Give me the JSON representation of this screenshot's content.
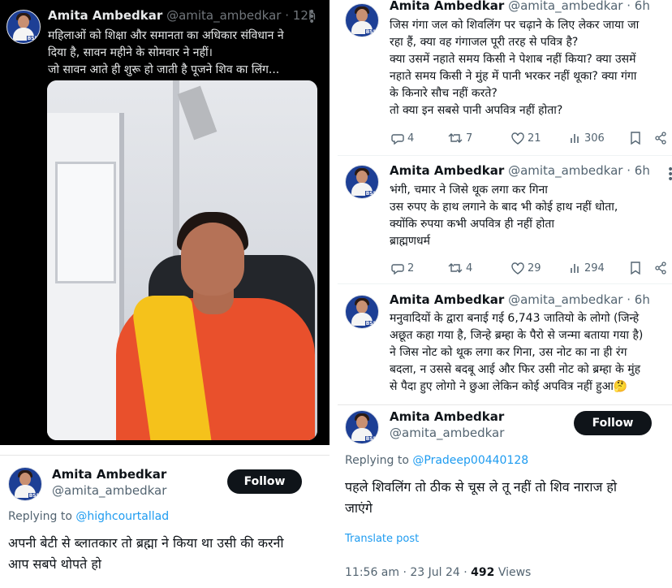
{
  "tweets": [
    {
      "id": "t1",
      "name": "Amita Ambedkar",
      "handle": "@amita_ambedkar",
      "time": "12h",
      "lines": [
        "महिलाओं को शिक्षा और समानता का अधिकार संविधान ने",
        "दिया है, सावन महीने के सोमवार ने नहीं।",
        "जो सावन आते ही शुरू हो जाती है पूजने शिव का लिंग..."
      ]
    },
    {
      "id": "t2",
      "name": "Amita Ambedkar",
      "handle": "@amita_ambedkar",
      "time": "6h",
      "lines": [
        "जिस गंगा जल को शिवलिंग पर चढ़ाने के लिए लेकर जाया जा",
        "रहा हैं, क्या वह गंगाजल पूरी तरह से पवित्र है?",
        "क्या उसमें नहाते समय किसी ने पेशाब नहीं किया? क्या उसमें",
        "नहाते समय किसी ने मुंह में पानी भरकर नहीं थूका? क्या गंगा",
        "के किनारे सौच नहीं करते?",
        "तो क्या इन सबसे पानी अपवित्र नहीं होता?"
      ],
      "replies": "4",
      "reposts": "7",
      "likes": "21",
      "views": "306"
    },
    {
      "id": "t3",
      "name": "Amita Ambedkar",
      "handle": "@amita_ambedkar",
      "time": "6h",
      "lines": [
        "भंगी, चमार ने जिसे थूक लगा कर गिना",
        "उस रुपए के हाथ लगाने के बाद भी कोई हाथ नहीं धोता,",
        "क्योंकि रुपया कभी अपवित्र ही नहीं होता",
        "ब्राह्मणधर्म"
      ],
      "replies": "2",
      "reposts": "4",
      "likes": "29",
      "views": "294"
    },
    {
      "id": "t4",
      "name": "Amita Ambedkar",
      "handle": "@amita_ambedkar",
      "time": "6h",
      "lines": [
        "मनुवादियों के द्वारा बनाई गई 6,743 जातियो के लोगो (जिन्हे",
        "अछूत कहा गया है, जिन्हे ब्रम्हा के पैरो से जन्मा बताया गया है)",
        "ने जिस नोट को थूक लगा कर गिना, उस नोट का ना ही रंग",
        "बदला, न उससे बदबू आई  और फिर उसी नोट को ब्रम्हा के मुंह",
        "से पैदा हुए लोगो ने छुआ लेकिन कोई अपवित्र नहीं हुआ🤔"
      ]
    },
    {
      "id": "t5",
      "name": "Amita Ambedkar",
      "handle": "@amita_ambedkar",
      "follow_label": "Follow",
      "replying_prefix": "Replying to",
      "replying_to": "@Pradeep00440128",
      "lines": [
        "पहले शिवलिंग तो ठीक से चूस ले तू नहीं तो शिव नाराज हो",
        "जाएंगे"
      ],
      "translate": "Translate post",
      "timestamp": "11:56 am · 23 Jul 24 · ",
      "views_count": "492",
      "views_label": " Views"
    },
    {
      "id": "t6",
      "name": "Amita Ambedkar",
      "handle": "@amita_ambedkar",
      "follow_label": "Follow",
      "replying_prefix": "Replying to",
      "replying_to": "@highcourtallad",
      "lines": [
        "अपनी बेटी से ब्लातकार तो ब्रह्मा ने किया था उसी की करनी",
        "आप सबपे थोपते हो"
      ]
    }
  ],
  "avatar_badge": "BSP",
  "icons": {
    "reply": "reply-icon",
    "repost": "repost-icon",
    "like": "heart-icon",
    "views": "views-icon",
    "bookmark": "bookmark-icon",
    "share": "share-icon",
    "more": "more-icon"
  },
  "colors": {
    "link": "#1d9bf0",
    "dark_bg": "#000000",
    "follow_bg": "#0f1419"
  }
}
